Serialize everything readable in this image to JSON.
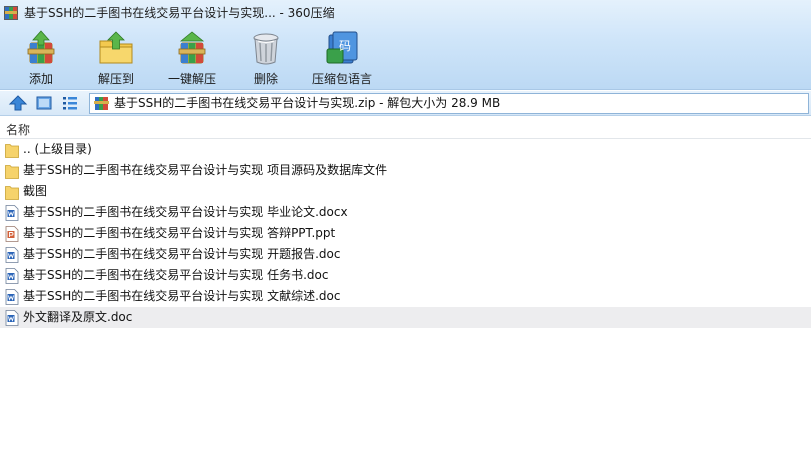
{
  "window": {
    "title": "基于SSH的二手图书在线交易平台设计与实现... - 360压缩",
    "app_icon": "winrar-books-icon"
  },
  "toolbar": {
    "items": [
      {
        "label": "添加",
        "icon": "add-archive-icon"
      },
      {
        "label": "解压到",
        "icon": "extract-to-icon"
      },
      {
        "label": "一键解压",
        "icon": "one-click-extract-icon"
      },
      {
        "label": "删除",
        "icon": "delete-trash-icon"
      },
      {
        "label": "压缩包语言",
        "icon": "archive-language-icon"
      }
    ]
  },
  "address": {
    "text": "基于SSH的二手图书在线交易平台设计与实现.zip - 解包大小为 28.9 MB"
  },
  "list": {
    "header_name": "名称",
    "rows": [
      {
        "name": ".. (上级目录)",
        "kind": "folder"
      },
      {
        "name": "基于SSH的二手图书在线交易平台设计与实现 项目源码及数据库文件",
        "kind": "folder"
      },
      {
        "name": "截图",
        "kind": "folder"
      },
      {
        "name": "基于SSH的二手图书在线交易平台设计与实现 毕业论文.docx",
        "kind": "word"
      },
      {
        "name": "基于SSH的二手图书在线交易平台设计与实现 答辩PPT.ppt",
        "kind": "ppt"
      },
      {
        "name": "基于SSH的二手图书在线交易平台设计与实现 开题报告.doc",
        "kind": "word"
      },
      {
        "name": "基于SSH的二手图书在线交易平台设计与实现 任务书.doc",
        "kind": "word"
      },
      {
        "name": "基于SSH的二手图书在线交易平台设计与实现 文献综述.doc",
        "kind": "word"
      },
      {
        "name": "外文翻译及原文.doc",
        "kind": "word",
        "selected": true
      }
    ]
  },
  "colors": {
    "chrome_top": "#e4f1fc",
    "chrome_bottom": "#bcd9f4",
    "folder": "#f6d36b",
    "word": "#2a64b8",
    "ppt": "#d2603a",
    "selected_row": "#ededef"
  }
}
